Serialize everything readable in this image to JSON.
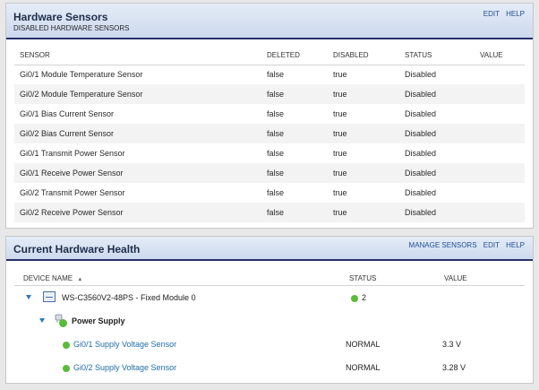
{
  "hardware_sensors": {
    "title": "Hardware Sensors",
    "subtitle": "DISABLED HARDWARE SENSORS",
    "links": [
      "EDIT",
      "HELP"
    ],
    "columns": [
      "SENSOR",
      "DELETED",
      "DISABLED",
      "STATUS",
      "VALUE"
    ],
    "rows": [
      {
        "sensor": "Gi0/1 Module Temperature Sensor",
        "deleted": "false",
        "disabled": "true",
        "status": "Disabled",
        "value": ""
      },
      {
        "sensor": "Gi0/2 Module Temperature Sensor",
        "deleted": "false",
        "disabled": "true",
        "status": "Disabled",
        "value": ""
      },
      {
        "sensor": "Gi0/1 Bias Current Sensor",
        "deleted": "false",
        "disabled": "true",
        "status": "Disabled",
        "value": ""
      },
      {
        "sensor": "Gi0/2 Bias Current Sensor",
        "deleted": "false",
        "disabled": "true",
        "status": "Disabled",
        "value": ""
      },
      {
        "sensor": "Gi0/1 Transmit Power Sensor",
        "deleted": "false",
        "disabled": "true",
        "status": "Disabled",
        "value": ""
      },
      {
        "sensor": "Gi0/1 Receive Power Sensor",
        "deleted": "false",
        "disabled": "true",
        "status": "Disabled",
        "value": ""
      },
      {
        "sensor": "Gi0/2 Transmit Power Sensor",
        "deleted": "false",
        "disabled": "true",
        "status": "Disabled",
        "value": ""
      },
      {
        "sensor": "Gi0/2 Receive Power Sensor",
        "deleted": "false",
        "disabled": "true",
        "status": "Disabled",
        "value": ""
      }
    ]
  },
  "hardware_health": {
    "title": "Current Hardware Health",
    "links": [
      "MANAGE SENSORS",
      "EDIT",
      "HELP"
    ],
    "columns": {
      "device": "DEVICE NAME",
      "sort_indicator": "▲",
      "status": "STATUS",
      "value": "VALUE"
    },
    "device": {
      "name": "WS-C3560V2-48PS - Fixed Module 0",
      "status_count": "2"
    },
    "group": {
      "name": "Power Supply"
    },
    "sensors": [
      {
        "name": "Gi0/1 Supply Voltage Sensor",
        "status": "NORMAL",
        "value": "3.3 V"
      },
      {
        "name": "Gi0/2 Supply Voltage Sensor",
        "status": "NORMAL",
        "value": "3.28 V"
      }
    ],
    "status_color": "#5bbb3a"
  }
}
